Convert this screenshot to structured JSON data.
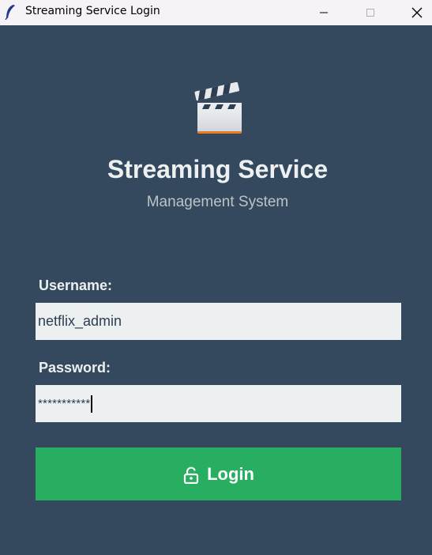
{
  "window": {
    "title": "Streaming Service Login",
    "controls": [
      "minimize-icon",
      "maximize-icon",
      "close-icon"
    ]
  },
  "header": {
    "logo_icon": "clapperboard-icon",
    "title": "Streaming Service",
    "subtitle": "Management System"
  },
  "form": {
    "username_label": "Username:",
    "username_value": "netflix_admin",
    "password_label": "Password:",
    "password_value": "***********",
    "login_icon": "unlock-icon",
    "login_label": "Login"
  },
  "colors": {
    "background": "#34495e",
    "input_background": "#ecf0f1",
    "button": "#27ae60",
    "text_light": "#ecf0f1",
    "subtitle": "#bdc3c7"
  }
}
